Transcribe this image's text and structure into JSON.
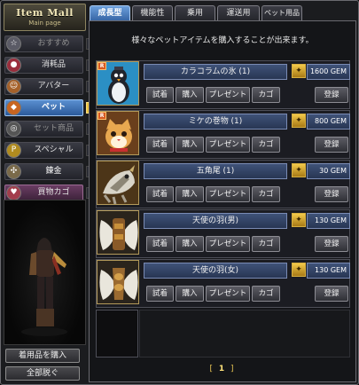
{
  "logo": {
    "title": "Item Mall",
    "subtitle": "Main page"
  },
  "categories": [
    {
      "label": "おすすめ",
      "icon": "star-icon",
      "state": "disabled"
    },
    {
      "label": "消耗品",
      "icon": "potion-icon",
      "state": "normal"
    },
    {
      "label": "アバター",
      "icon": "avatar-icon",
      "state": "normal"
    },
    {
      "label": "ペット",
      "icon": "pet-icon",
      "state": "selected"
    },
    {
      "label": "セット商品",
      "icon": "set-icon",
      "state": "disabled"
    },
    {
      "label": "スペシャル",
      "icon": "special-icon",
      "state": "normal"
    },
    {
      "label": "錬金",
      "icon": "alchemy-icon",
      "state": "normal"
    },
    {
      "label": "買物カゴ",
      "icon": "cart-icon",
      "state": "cart"
    }
  ],
  "left_buttons": {
    "wear_items": "着用品を購入",
    "unequip_all": "全部脱ぐ"
  },
  "tabs": [
    {
      "label": "成長型",
      "active": true
    },
    {
      "label": "機能性",
      "active": false
    },
    {
      "label": "乗用",
      "active": false
    },
    {
      "label": "運送用",
      "active": false
    },
    {
      "label": "ペット用品",
      "active": false
    }
  ],
  "subtitle": "様々なペットアイテムを購入することが出来ます。",
  "actions": {
    "try_on": "試着",
    "buy": "購入",
    "gift": "プレゼント",
    "cart": "カゴ",
    "register": "登録"
  },
  "items": [
    {
      "name": "カラコラムの氷 (1)",
      "price": "1600 GEM",
      "thumb": "penguin-pet",
      "badge": "R"
    },
    {
      "name": "ミケの巻物 (1)",
      "price": "800 GEM",
      "thumb": "cat-pet",
      "badge": "R"
    },
    {
      "name": "五角尾 (1)",
      "price": "30 GEM",
      "thumb": "armored-pet",
      "badge": ""
    },
    {
      "name": "天使の羽(男)",
      "price": "130 GEM",
      "thumb": "angel-wings-male",
      "badge": ""
    },
    {
      "name": "天使の羽(女)",
      "price": "130 GEM",
      "thumb": "angel-wings-female",
      "badge": ""
    }
  ],
  "pagination": {
    "left_bracket": "[",
    "current": "1",
    "right_bracket": "]"
  },
  "colors": {
    "accent": "#3d6fb3",
    "gem": "#f3c94a",
    "frame": "#1b1c1f"
  }
}
